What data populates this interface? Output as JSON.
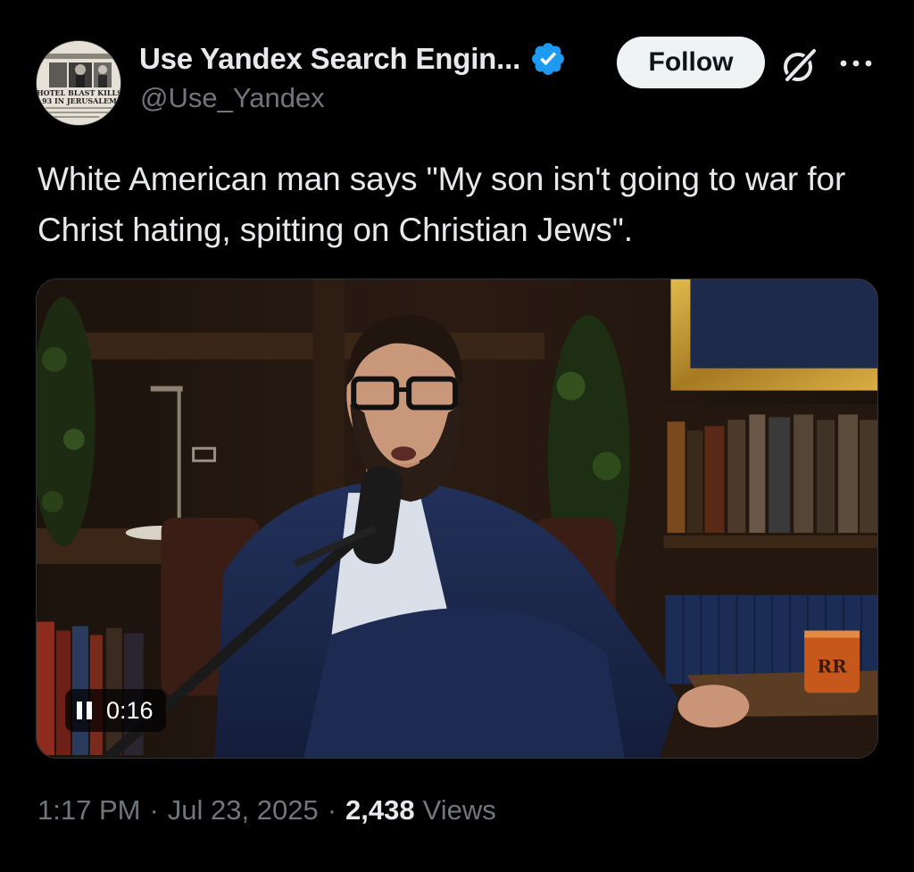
{
  "author": {
    "display_name": "Use Yandex Search Engin...",
    "handle": "@Use_Yandex",
    "avatar_caption_line1": "HOTEL BLAST KILLS",
    "avatar_caption_line2": "93 IN JERUSALEM",
    "verified": true,
    "verified_color": "#1d9bf0"
  },
  "actions": {
    "follow_label": "Follow",
    "grok_icon": "grok-icon",
    "more_icon": "more-horizontal-icon"
  },
  "tweet": {
    "text": "White American man says \"My son isn't going to war for Christ hating, spitting on Christian Jews\"."
  },
  "video": {
    "elapsed": "0:16",
    "state_icon": "pause-icon",
    "mug_logo": "RR"
  },
  "meta": {
    "time": "1:17 PM",
    "separator": "·",
    "date": "Jul 23, 2025",
    "views_count": "2,438",
    "views_label": "Views"
  },
  "colors": {
    "background": "#000000",
    "primary_text": "#e7e9ea",
    "secondary_text": "#71767b",
    "follow_bg": "#eff3f4",
    "follow_text": "#0f1419",
    "border": "#2f3336"
  }
}
